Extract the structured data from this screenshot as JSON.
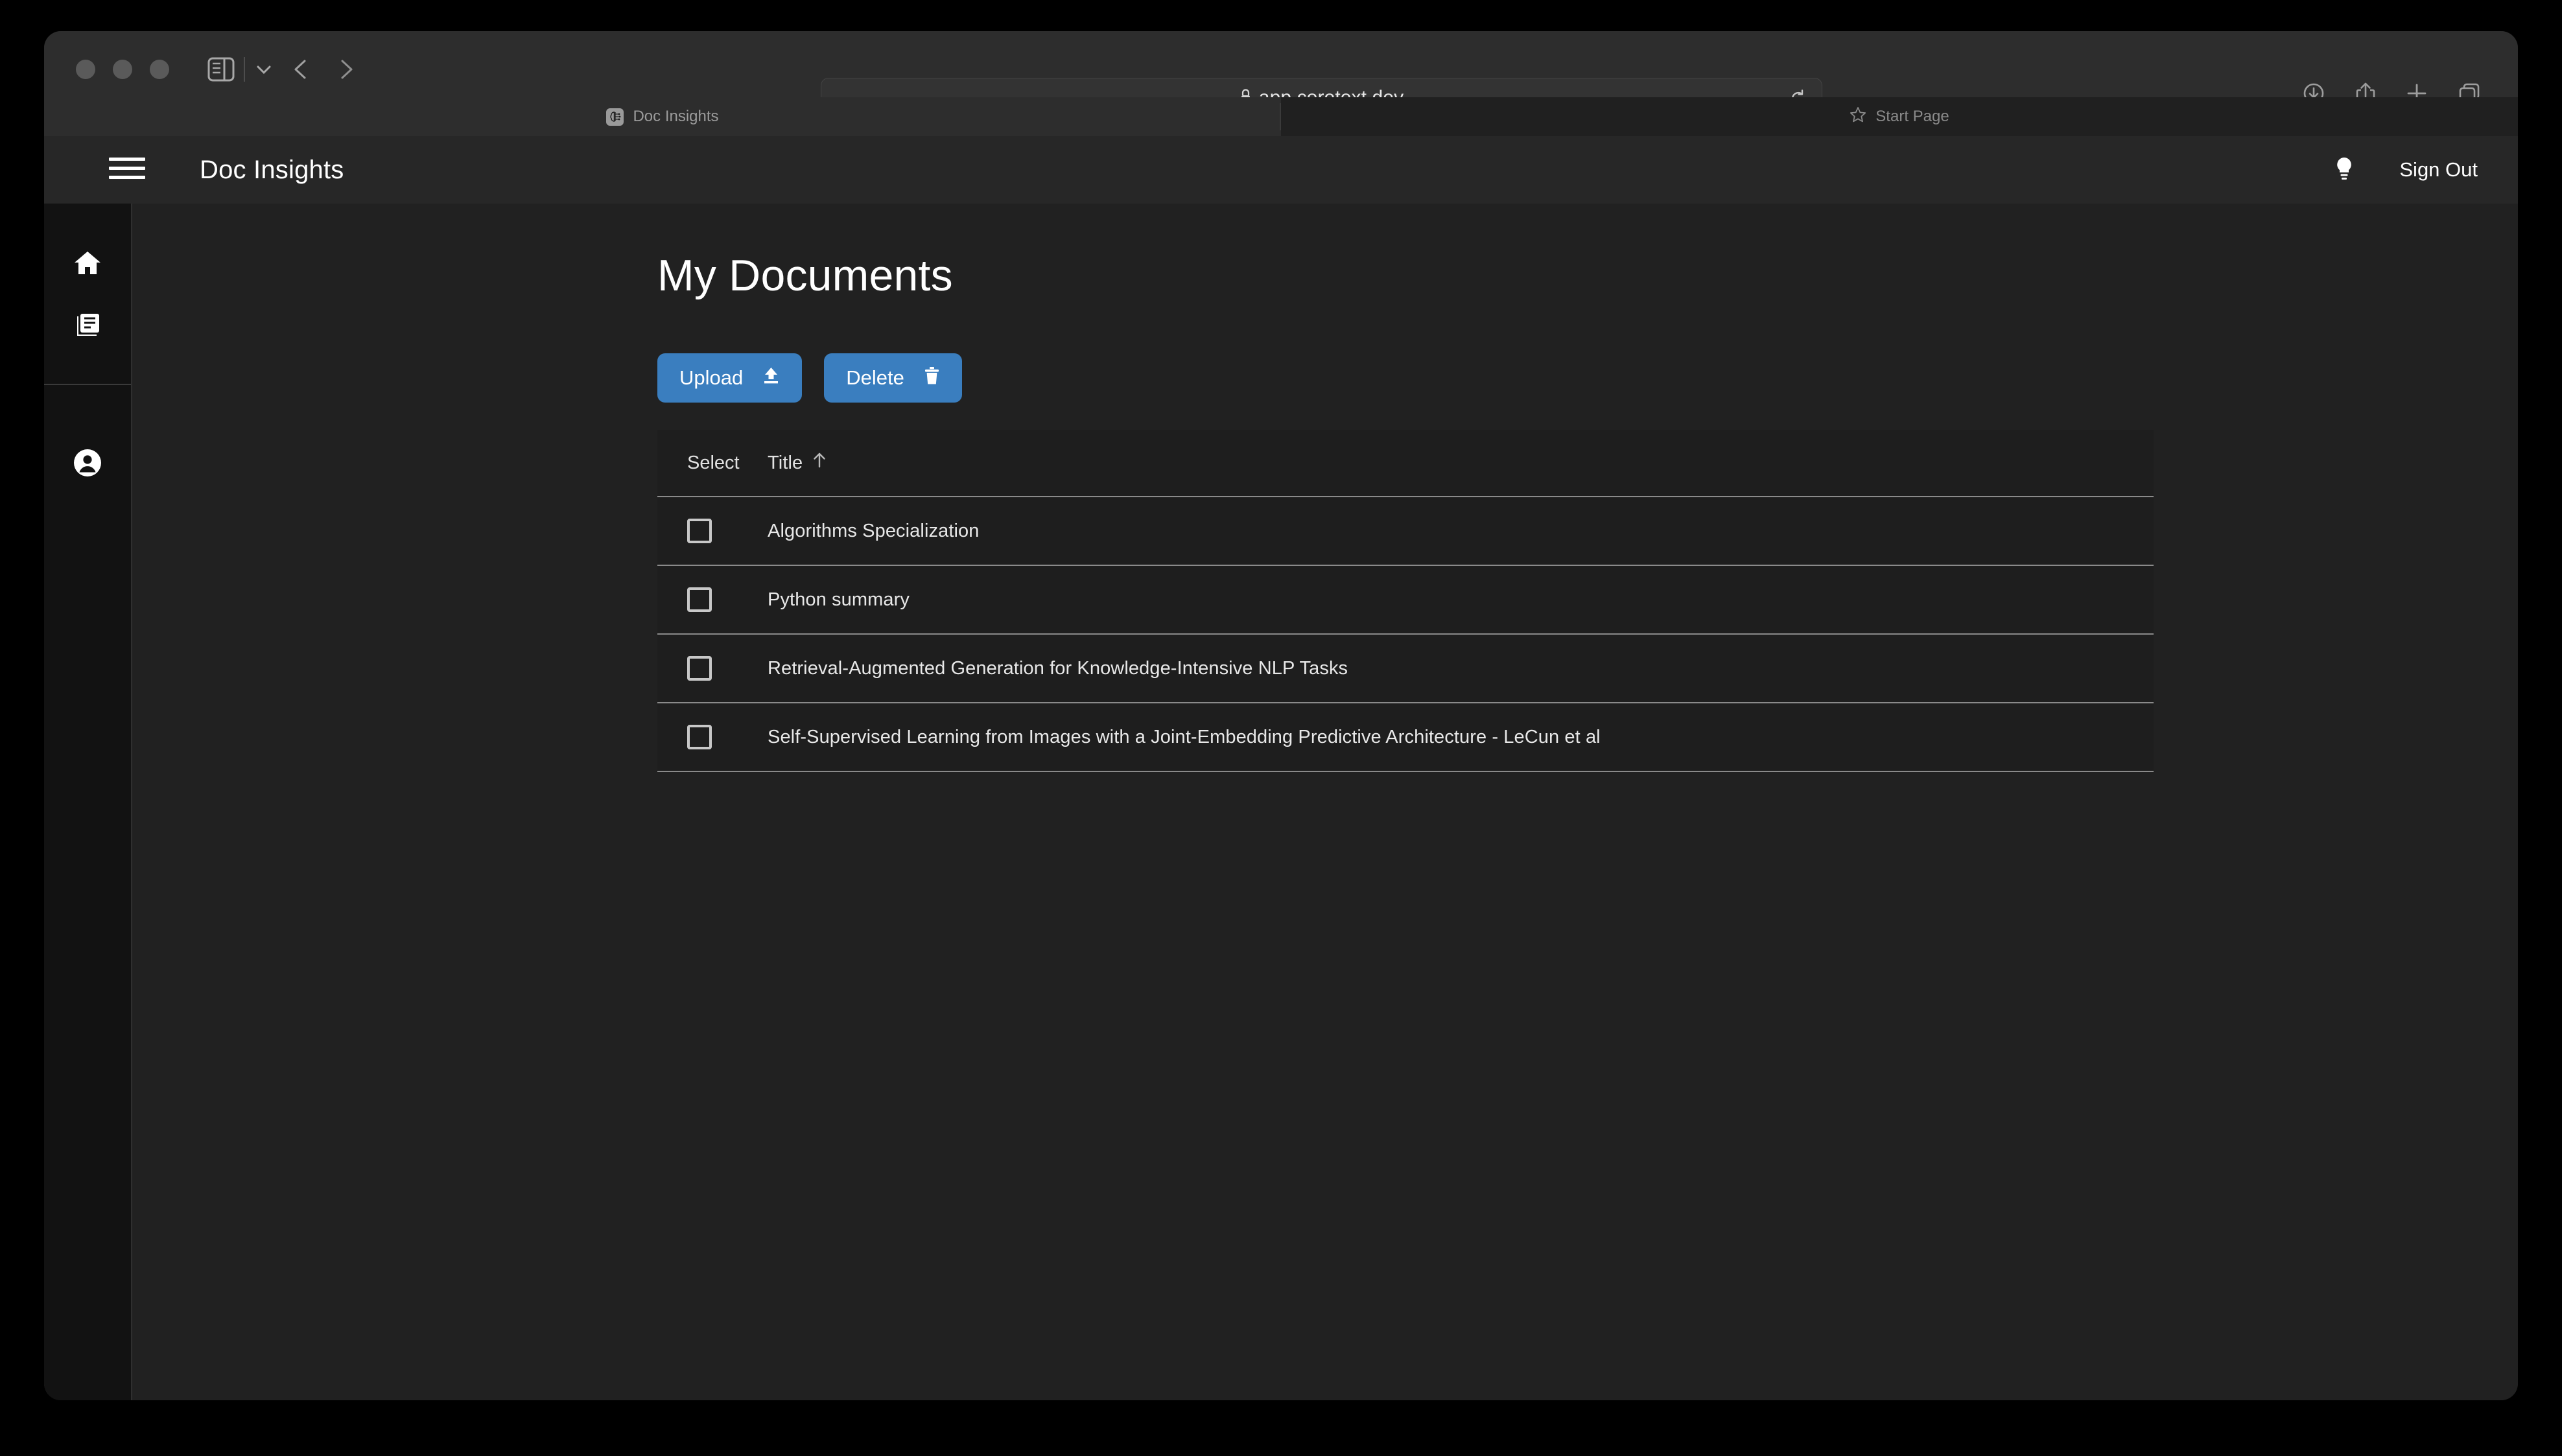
{
  "browser": {
    "url": "app.coretext.dev",
    "lock_icon": "lock-icon",
    "reload_icon": "reload-icon",
    "back_icon": "chevron-left-icon",
    "forward_icon": "chevron-right-icon",
    "sidebar_toggle_icon": "sidebar-toggle-icon",
    "downloads_icon": "downloads-icon",
    "share_icon": "share-icon",
    "new_tab_icon": "plus-icon",
    "tab_overview_icon": "tab-overview-icon",
    "tabs": [
      {
        "label": "Doc Insights",
        "icon": "brain-favicon",
        "active": true
      },
      {
        "label": "Start Page",
        "icon": "star-icon",
        "active": false
      }
    ]
  },
  "header": {
    "menu_icon": "hamburger-menu-icon",
    "title": "Doc Insights",
    "theme_icon": "lightbulb-icon",
    "sign_out_label": "Sign Out"
  },
  "sidebar": {
    "items": [
      {
        "name": "home",
        "icon": "home-icon"
      },
      {
        "name": "documents",
        "icon": "documents-icon"
      },
      {
        "name": "account",
        "icon": "account-circle-icon"
      }
    ]
  },
  "main": {
    "page_title": "My Documents",
    "buttons": [
      {
        "label": "Upload",
        "icon": "upload-icon"
      },
      {
        "label": "Delete",
        "icon": "trash-icon"
      }
    ],
    "table": {
      "columns": [
        {
          "key": "select",
          "label": "Select"
        },
        {
          "key": "title",
          "label": "Title",
          "sort": "ascending",
          "sort_icon": "arrow-up-icon"
        }
      ],
      "rows": [
        {
          "selected": false,
          "title": "Algorithms Specialization"
        },
        {
          "selected": false,
          "title": "Python summary"
        },
        {
          "selected": false,
          "title": "Retrieval-Augmented Generation for Knowledge-Intensive NLP Tasks"
        },
        {
          "selected": false,
          "title": "Self-Supervised Learning from Images with a Joint-Embedding Predictive Architecture - LeCun et al"
        }
      ]
    }
  },
  "colors": {
    "accent": "#3a7ebf",
    "page_bg": "#212121",
    "sidebar_bg": "#121212",
    "header_bg": "#272727",
    "table_bg": "#1e1e1e"
  }
}
